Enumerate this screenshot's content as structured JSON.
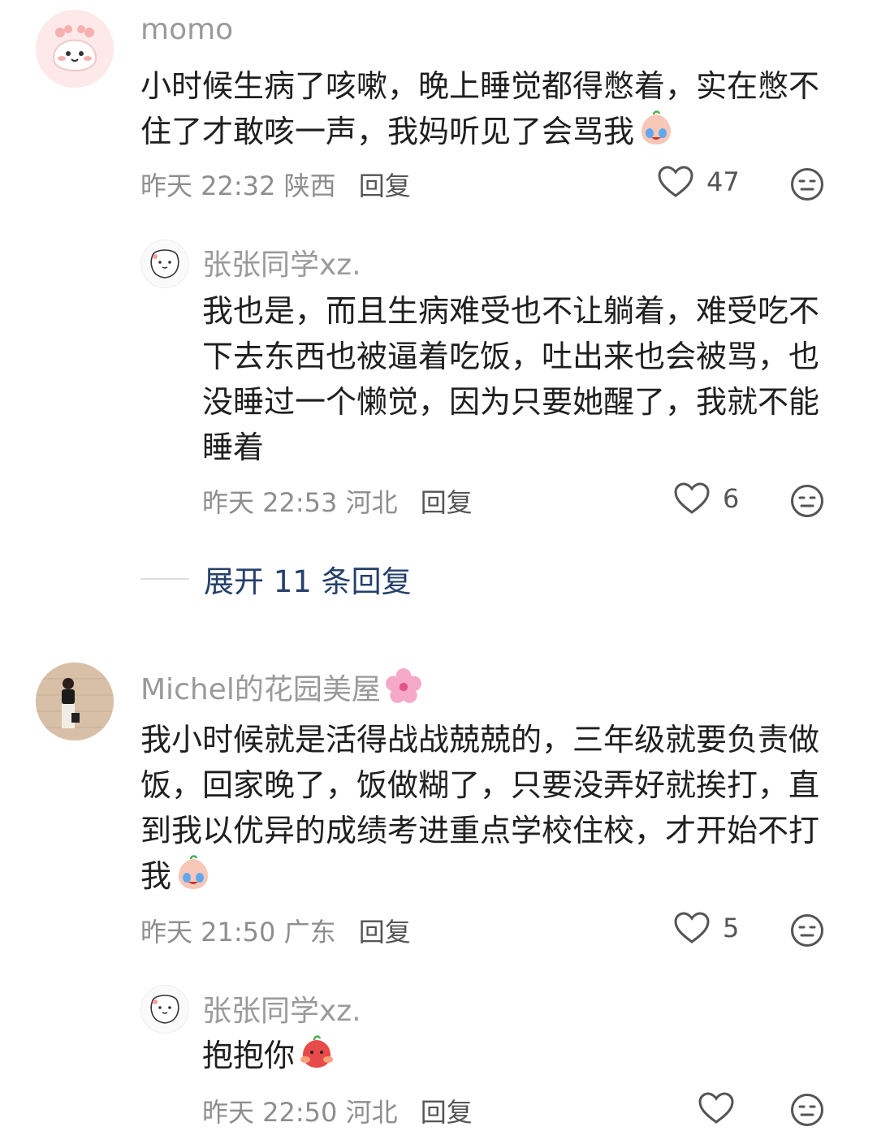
{
  "comments": [
    {
      "username": "momo",
      "text": "小时候生病了咳嗽，晚上睡觉都得憋着，实在憋不住了才敢咳一声，我妈听见了会骂我",
      "emoji": "crying-peach-emoji",
      "time": "昨天 22:32",
      "location": "陕西",
      "reply_label": "回复",
      "likes": "47",
      "replies": [
        {
          "username": "张张同学xz.",
          "text": "我也是，而且生病难受也不让躺着，难受吃不下去东西也被逼着吃饭，吐出来也会被骂，也没睡过一个懒觉，因为只要她醒了，我就不能睡着",
          "time": "昨天 22:53",
          "location": "河北",
          "reply_label": "回复",
          "likes": "6"
        }
      ],
      "expand_label": "展开 11 条回复"
    },
    {
      "username": "Michel的花园美屋",
      "username_emoji": "cherry-blossom-emoji",
      "text": "我小时候就是活得战战兢兢的，三年级就要负责做饭，回家晚了，饭做糊了，只要没弄好就挨打，直到我以优异的成绩考进重点学校住校，才开始不打我",
      "emoji": "crying-peach-emoji",
      "time": "昨天 21:50",
      "location": "广东",
      "reply_label": "回复",
      "likes": "5",
      "replies": [
        {
          "username": "张张同学xz.",
          "text": "抱抱你",
          "emoji": "hug-peach-emoji",
          "time": "昨天 22:50",
          "location": "河北",
          "reply_label": "回复",
          "likes": ""
        }
      ]
    }
  ],
  "colors": {
    "username": "#9a9a9a",
    "text": "#1f1f1f",
    "meta": "#8e8e8e",
    "expand": "#24406b"
  }
}
